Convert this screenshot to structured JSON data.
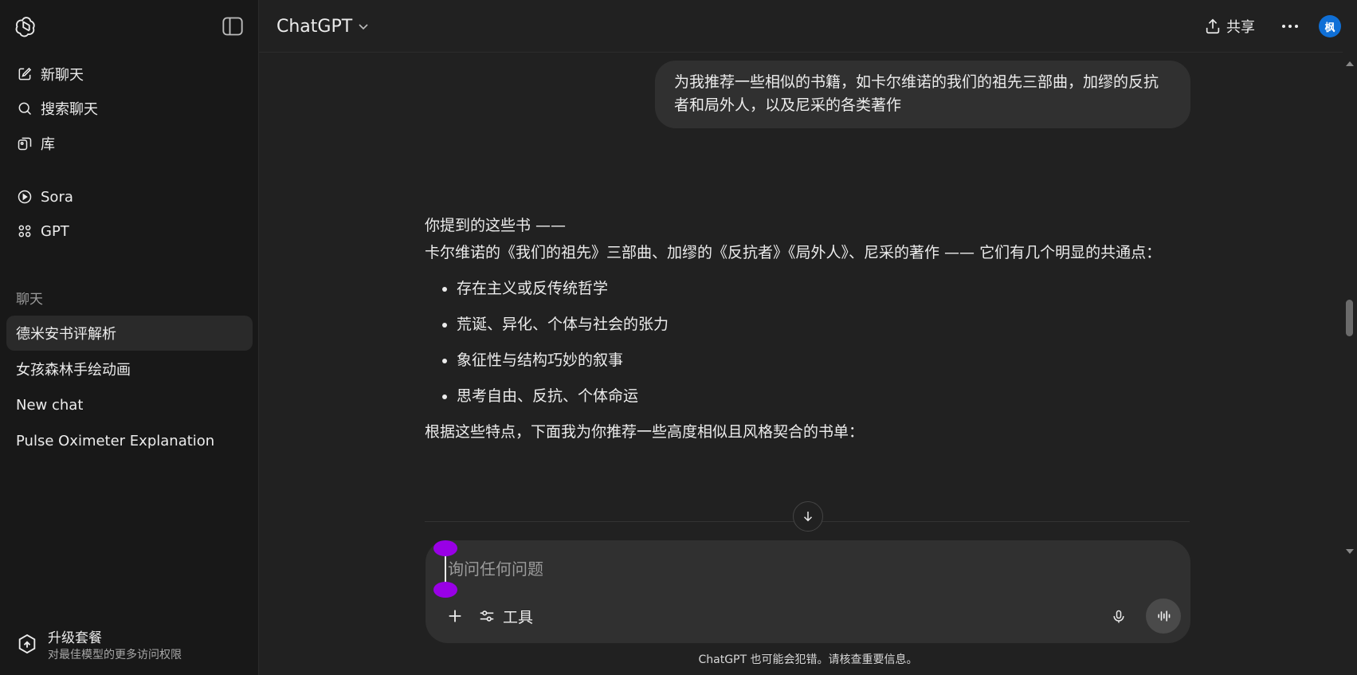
{
  "sidebar": {
    "items": [
      {
        "label": "新聊天",
        "icon": "new-chat-icon"
      },
      {
        "label": "搜索聊天",
        "icon": "search-icon"
      },
      {
        "label": "库",
        "icon": "library-icon"
      },
      {
        "label": "Sora",
        "icon": "play-icon"
      },
      {
        "label": "GPT",
        "icon": "gpt-grid-icon"
      }
    ],
    "section_title": "聊天",
    "chats": [
      "德米安书评解析",
      "女孩森林手绘动画",
      "New chat",
      "Pulse Oximeter Explanation"
    ],
    "upgrade": {
      "title": "升级套餐",
      "subtitle": "对最佳模型的更多访问权限"
    }
  },
  "header": {
    "model": "ChatGPT",
    "share_label": "共享",
    "avatar_text": "枫"
  },
  "conversation": {
    "user_message": "为我推荐一些相似的书籍，如卡尔维诺的我们的祖先三部曲，加缪的反抗者和局外人，以及尼采的各类著作",
    "assistant": {
      "intro_line1": "你提到的这些书 ——",
      "intro_line2": "卡尔维诺的《我们的祖先》三部曲、加缪的《反抗者》《局外人》、尼采的著作 —— 它们有几个明显的共通点：",
      "bullets": [
        "存在主义或反传统哲学",
        "荒诞、异化、个体与社会的张力",
        "象征性与结构巧妙的叙事",
        "思考自由、反抗、个体命运"
      ],
      "closing": "根据这些特点，下面我为你推荐一些高度相似且风格契合的书单："
    }
  },
  "composer": {
    "placeholder": "询问任何问题",
    "tools_label": "工具"
  },
  "disclaimer": "ChatGPT 也可能会犯错。请核查重要信息。",
  "colors": {
    "background": "#212121",
    "sidebar": "#181818",
    "bubble": "#303030",
    "avatar": "#0f6fd6",
    "handle": "#9900e6"
  }
}
